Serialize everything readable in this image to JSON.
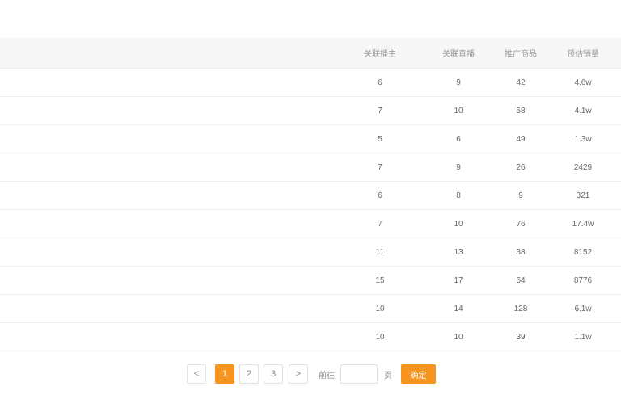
{
  "table": {
    "headers": [
      "关联播主",
      "关联直播",
      "推广商品",
      "预估销量"
    ],
    "rows": [
      [
        "6",
        "9",
        "42",
        "4.6w"
      ],
      [
        "7",
        "10",
        "58",
        "4.1w"
      ],
      [
        "5",
        "6",
        "49",
        "1.3w"
      ],
      [
        "7",
        "9",
        "26",
        "2429"
      ],
      [
        "6",
        "8",
        "9",
        "321"
      ],
      [
        "7",
        "10",
        "76",
        "17.4w"
      ],
      [
        "11",
        "13",
        "38",
        "8152"
      ],
      [
        "15",
        "17",
        "64",
        "8776"
      ],
      [
        "10",
        "14",
        "128",
        "6.1w"
      ],
      [
        "10",
        "10",
        "39",
        "1.1w"
      ]
    ]
  },
  "pagination": {
    "prev": "<",
    "pages": [
      "1",
      "2",
      "3"
    ],
    "current": "1",
    "next": ">",
    "goto_label": "前往",
    "goto_value": "",
    "page_suffix": "页",
    "confirm": "确定"
  },
  "colors": {
    "accent": "#f7941d",
    "header_bg": "#f7f7f7",
    "border": "#efefef"
  }
}
